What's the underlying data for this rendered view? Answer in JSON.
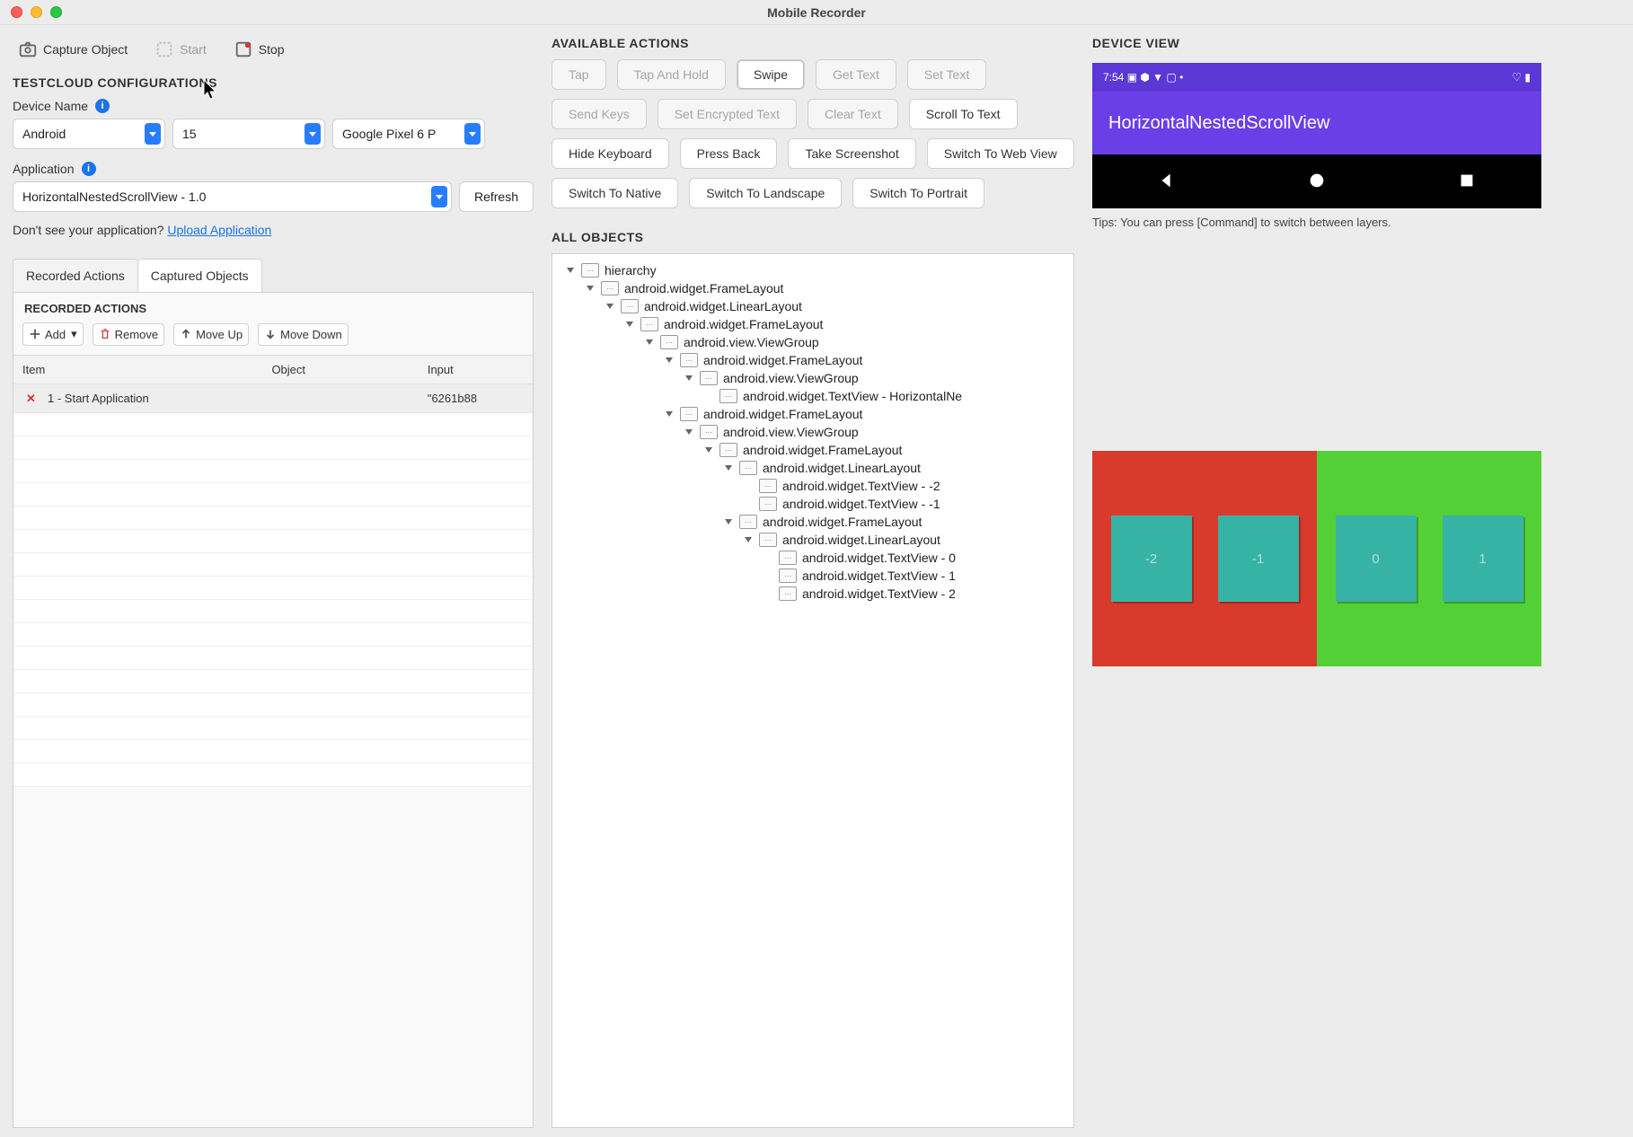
{
  "window": {
    "title": "Mobile Recorder"
  },
  "toolbar": {
    "capture_label": "Capture Object",
    "start_label": "Start",
    "stop_label": "Stop"
  },
  "config": {
    "heading": "TESTCLOUD CONFIGURATIONS",
    "device_name_label": "Device Name",
    "platform": "Android",
    "os_version": "15",
    "device_model": "Google Pixel 6 P",
    "application_label": "Application",
    "application_value": "HorizontalNestedScrollView - 1.0",
    "refresh_label": "Refresh",
    "no_app_text": "Don't see your application? ",
    "upload_link": "Upload Application"
  },
  "tabs": {
    "recorded": "Recorded Actions",
    "captured": "Captured Objects"
  },
  "recorded": {
    "heading": "RECORDED ACTIONS",
    "tools": {
      "add": "Add",
      "remove": "Remove",
      "move_up": "Move Up",
      "move_down": "Move Down"
    },
    "columns": {
      "item": "Item",
      "object": "Object",
      "input": "Input"
    },
    "rows": [
      {
        "item": "1 - Start Application",
        "object": "",
        "input": "\"6261b88"
      }
    ]
  },
  "actions": {
    "heading": "AVAILABLE ACTIONS",
    "items": [
      {
        "label": "Tap",
        "disabled": true
      },
      {
        "label": "Tap And Hold",
        "disabled": true
      },
      {
        "label": "Swipe",
        "active": true
      },
      {
        "label": "Get Text",
        "disabled": true
      },
      {
        "label": "Set Text",
        "disabled": true
      },
      {
        "label": "Send Keys",
        "disabled": true
      },
      {
        "label": "Set Encrypted Text",
        "disabled": true
      },
      {
        "label": "Clear Text",
        "disabled": true
      },
      {
        "label": "Scroll To Text"
      },
      {
        "label": "Hide Keyboard"
      },
      {
        "label": "Press Back"
      },
      {
        "label": "Take Screenshot"
      },
      {
        "label": "Switch To Web View"
      },
      {
        "label": "Switch To Native"
      },
      {
        "label": "Switch To Landscape"
      },
      {
        "label": "Switch To Portrait"
      }
    ]
  },
  "objects": {
    "heading": "ALL OBJECTS",
    "tree": [
      {
        "d": 0,
        "c": true,
        "label": "hierarchy"
      },
      {
        "d": 1,
        "c": true,
        "label": "android.widget.FrameLayout"
      },
      {
        "d": 2,
        "c": true,
        "label": "android.widget.LinearLayout"
      },
      {
        "d": 3,
        "c": true,
        "label": "android.widget.FrameLayout"
      },
      {
        "d": 4,
        "c": true,
        "label": "android.view.ViewGroup"
      },
      {
        "d": 5,
        "c": true,
        "label": "android.widget.FrameLayout"
      },
      {
        "d": 6,
        "c": true,
        "label": "android.view.ViewGroup"
      },
      {
        "d": 7,
        "c": false,
        "label": "android.widget.TextView - HorizontalNe"
      },
      {
        "d": 5,
        "c": true,
        "label": "android.widget.FrameLayout"
      },
      {
        "d": 6,
        "c": true,
        "label": "android.view.ViewGroup"
      },
      {
        "d": 7,
        "c": true,
        "label": "android.widget.FrameLayout"
      },
      {
        "d": 8,
        "c": true,
        "label": "android.widget.LinearLayout"
      },
      {
        "d": 9,
        "c": false,
        "label": "android.widget.TextView - -2"
      },
      {
        "d": 9,
        "c": false,
        "label": "android.widget.TextView - -1"
      },
      {
        "d": 8,
        "c": true,
        "label": "android.widget.FrameLayout"
      },
      {
        "d": 9,
        "c": true,
        "label": "android.widget.LinearLayout"
      },
      {
        "d": 10,
        "c": false,
        "label": "android.widget.TextView - 0"
      },
      {
        "d": 10,
        "c": false,
        "label": "android.widget.TextView - 1"
      },
      {
        "d": 10,
        "c": false,
        "label": "android.widget.TextView - 2"
      }
    ]
  },
  "device": {
    "heading": "DEVICE VIEW",
    "time": "7:54",
    "status_icons": "▣ ⬢ ▼ ▢  •",
    "right_icons": "♡ ▮",
    "app_title": "HorizontalNestedScrollView",
    "tiles_left": [
      "-2",
      "-1"
    ],
    "tiles_right": [
      "0",
      "1"
    ],
    "tips": "Tips: You can press [Command] to switch between layers."
  }
}
